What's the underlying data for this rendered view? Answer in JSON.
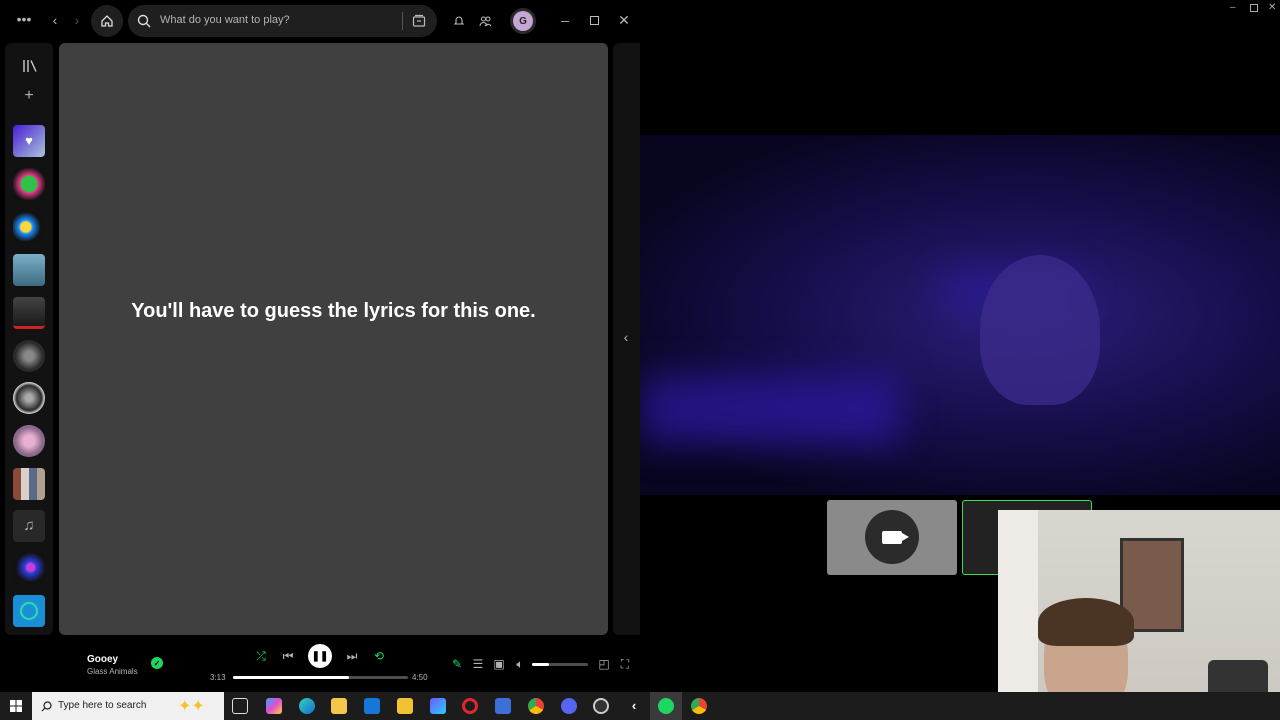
{
  "spotify": {
    "search_placeholder": "What do you want to play?",
    "avatar_letter": "G",
    "lyrics_message": "You'll have to guess the lyrics for this one.",
    "now_playing": {
      "title": "Gooey",
      "artist": "Glass Animals",
      "elapsed": "3:13",
      "duration": "4:50",
      "progress": 0.66,
      "volume": 0.3
    },
    "icons": {
      "more": "more-icon",
      "back": "back-icon",
      "forward": "forward-icon",
      "home": "home-icon",
      "search": "search-icon",
      "browse": "browse-icon",
      "notifications": "bell-icon",
      "friends": "friends-icon",
      "library": "library-icon",
      "add": "plus-icon"
    },
    "colors": {
      "accent": "#1ed760",
      "panel": "#404040"
    }
  },
  "taskbar": {
    "search_placeholder": "Type here to search"
  }
}
